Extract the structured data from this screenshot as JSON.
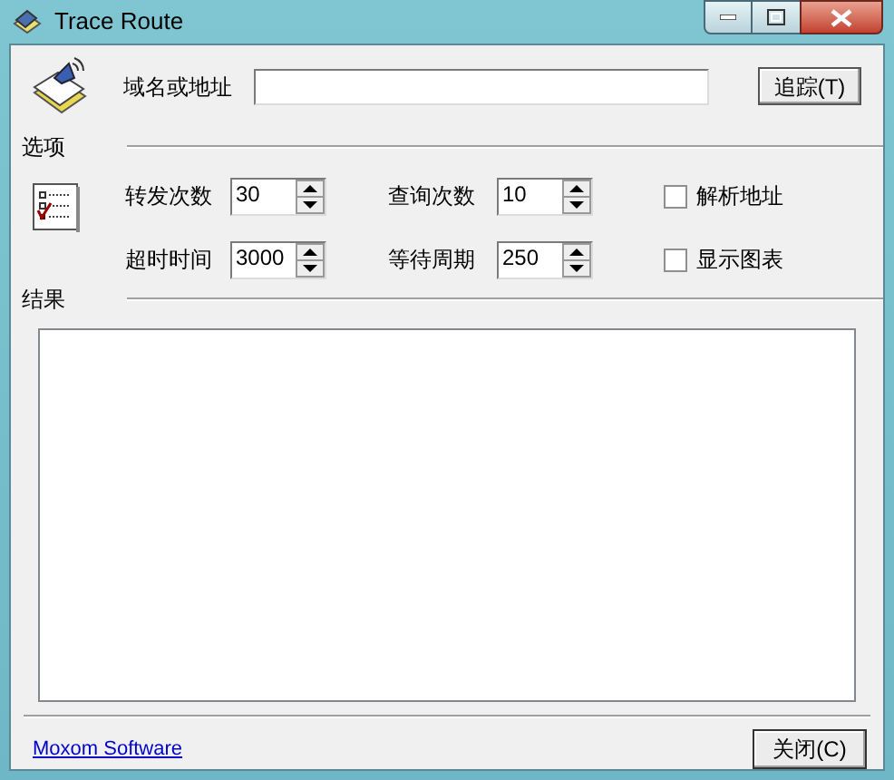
{
  "window": {
    "title": "Trace Route"
  },
  "address": {
    "label": "域名或地址"
  },
  "trace_button": "追踪(T)",
  "options_heading": "选项",
  "spin_fields": [
    {
      "label": "转发次数",
      "value": "30"
    },
    {
      "label": "查询次数",
      "value": "10"
    },
    {
      "label": "超时时间",
      "value": "3000"
    },
    {
      "label": "等待周期",
      "value": "250"
    }
  ],
  "checkboxes": [
    {
      "label": "解析地址",
      "checked": false
    },
    {
      "label": "显示图表",
      "checked": false
    }
  ],
  "results_heading": "结果",
  "link": "Moxom Software",
  "close_button": "关闭(C)"
}
